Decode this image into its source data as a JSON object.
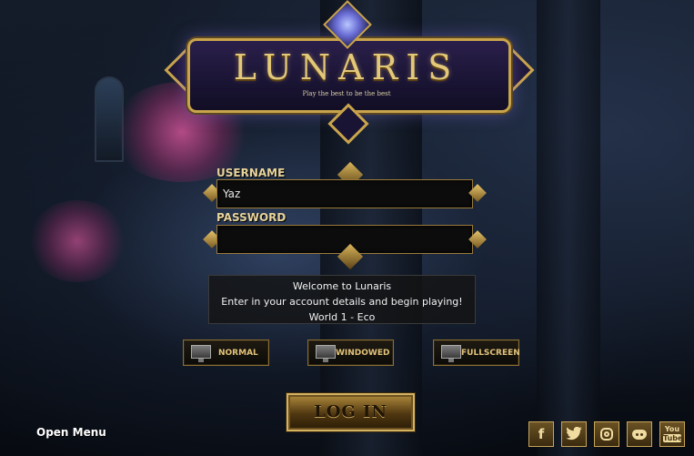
{
  "logo": {
    "title": "LUNARIS",
    "tagline": "Play the best to be the best"
  },
  "login_form": {
    "username_label": "USERNAME",
    "username_value": "Yaz",
    "password_label": "PASSWORD",
    "password_value": ""
  },
  "message": {
    "line1": "Welcome to Lunaris",
    "line2": "Enter in your account details and begin playing!",
    "line3": "World 1 - Eco"
  },
  "display_modes": [
    {
      "label": "NORMAL",
      "icon": "monitor-icon"
    },
    {
      "label": "WINDOWED",
      "icon": "monitor-icon"
    },
    {
      "label": "FULLSCREEN",
      "icon": "monitor-icon"
    }
  ],
  "login_button": "LOG IN",
  "open_menu": "Open Menu",
  "social": {
    "facebook": "f",
    "youtube_top": "You",
    "youtube_bottom": "Tube"
  },
  "colors": {
    "gold": "#c9a44c",
    "label_gold": "#e8d39a",
    "field_bg": "#0c0c0c"
  }
}
